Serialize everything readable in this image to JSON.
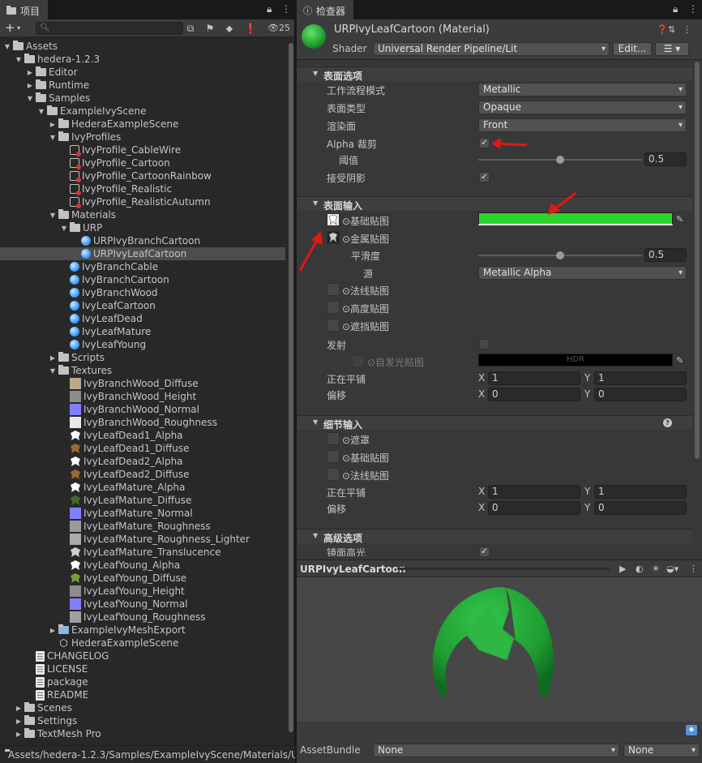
{
  "project": {
    "tab_title": "项目",
    "search_placeholder": "",
    "hidden_count": "25",
    "tree": [
      {
        "label": "Assets",
        "icon": "folder-open-icon",
        "depth": 0,
        "expanded": true
      },
      {
        "label": "hedera-1.2.3",
        "icon": "folder-open-icon",
        "depth": 1,
        "expanded": true
      },
      {
        "label": "Editor",
        "icon": "folder-icon",
        "depth": 2,
        "expanded": false
      },
      {
        "label": "Runtime",
        "icon": "folder-icon",
        "depth": 2,
        "expanded": false
      },
      {
        "label": "Samples",
        "icon": "folder-open-icon",
        "depth": 2,
        "expanded": true
      },
      {
        "label": "ExampleIvyScene",
        "icon": "folder-open-icon",
        "depth": 3,
        "expanded": true
      },
      {
        "label": "HederaExampleScene",
        "icon": "folder-icon",
        "depth": 4,
        "expanded": false
      },
      {
        "label": "IvyProfiles",
        "icon": "folder-open-icon",
        "depth": 4,
        "expanded": true
      },
      {
        "label": "IvyProfile_CableWire",
        "icon": "profile-icon",
        "depth": 5
      },
      {
        "label": "IvyProfile_Cartoon",
        "icon": "profile-icon",
        "depth": 5
      },
      {
        "label": "IvyProfile_CartoonRainbow",
        "icon": "profile-icon",
        "depth": 5
      },
      {
        "label": "IvyProfile_Realistic",
        "icon": "profile-icon",
        "depth": 5
      },
      {
        "label": "IvyProfile_RealisticAutumn",
        "icon": "profile-icon",
        "depth": 5
      },
      {
        "label": "Materials",
        "icon": "folder-open-icon",
        "depth": 4,
        "expanded": true
      },
      {
        "label": "URP",
        "icon": "folder-open-icon",
        "depth": 5,
        "expanded": true
      },
      {
        "label": "URPIvyBranchCartoon",
        "icon": "material-icon",
        "depth": 6
      },
      {
        "label": "URPIvyLeafCartoon",
        "icon": "material-icon",
        "depth": 6,
        "selected": true
      },
      {
        "label": "IvyBranchCable",
        "icon": "material-icon",
        "depth": 5
      },
      {
        "label": "IvyBranchCartoon",
        "icon": "material-icon",
        "depth": 5
      },
      {
        "label": "IvyBranchWood",
        "icon": "material-icon",
        "depth": 5
      },
      {
        "label": "IvyLeafCartoon",
        "icon": "material-icon",
        "depth": 5
      },
      {
        "label": "IvyLeafDead",
        "icon": "material-icon",
        "depth": 5
      },
      {
        "label": "IvyLeafMature",
        "icon": "material-icon",
        "depth": 5
      },
      {
        "label": "IvyLeafYoung",
        "icon": "material-icon",
        "depth": 5
      },
      {
        "label": "Scripts",
        "icon": "folder-icon",
        "depth": 4,
        "expanded": false
      },
      {
        "label": "Textures",
        "icon": "folder-open-icon",
        "depth": 4,
        "expanded": true
      },
      {
        "label": "IvyBranchWood_Diffuse",
        "icon": "texture-icon",
        "depth": 5,
        "swatch": "#b9a98a"
      },
      {
        "label": "IvyBranchWood_Height",
        "icon": "texture-icon",
        "depth": 5,
        "swatch": "#8c8c8c"
      },
      {
        "label": "IvyBranchWood_Normal",
        "icon": "texture-icon",
        "depth": 5,
        "swatch": "#8080ff"
      },
      {
        "label": "IvyBranchWood_Roughness",
        "icon": "texture-icon",
        "depth": 5,
        "swatch": "#e8e8e8"
      },
      {
        "label": "IvyLeafDead1_Alpha",
        "icon": "leaf-texture-icon",
        "depth": 5,
        "swatch": "#ffffff"
      },
      {
        "label": "IvyLeafDead1_Diffuse",
        "icon": "leaf-texture-icon",
        "depth": 5,
        "swatch": "#9a6a30"
      },
      {
        "label": "IvyLeafDead2_Alpha",
        "icon": "leaf-texture-icon",
        "depth": 5,
        "swatch": "#ffffff"
      },
      {
        "label": "IvyLeafDead2_Diffuse",
        "icon": "leaf-texture-icon",
        "depth": 5,
        "swatch": "#9a6a30"
      },
      {
        "label": "IvyLeafMature_Alpha",
        "icon": "leaf-texture-icon",
        "depth": 5,
        "swatch": "#ffffff"
      },
      {
        "label": "IvyLeafMature_Diffuse",
        "icon": "leaf-texture-icon",
        "depth": 5,
        "swatch": "#3f6a2a"
      },
      {
        "label": "IvyLeafMature_Normal",
        "icon": "texture-icon",
        "depth": 5,
        "swatch": "#8080ff"
      },
      {
        "label": "IvyLeafMature_Roughness",
        "icon": "texture-icon",
        "depth": 5,
        "swatch": "#9a9a9a"
      },
      {
        "label": "IvyLeafMature_Roughness_Lighter",
        "icon": "texture-icon",
        "depth": 5,
        "swatch": "#aaaaaa"
      },
      {
        "label": "IvyLeafMature_Translucence",
        "icon": "leaf-texture-icon",
        "depth": 5,
        "swatch": "#cfcfcf"
      },
      {
        "label": "IvyLeafYoung_Alpha",
        "icon": "leaf-texture-icon",
        "depth": 5,
        "swatch": "#ffffff"
      },
      {
        "label": "IvyLeafYoung_Diffuse",
        "icon": "leaf-texture-icon",
        "depth": 5,
        "swatch": "#6fa03a"
      },
      {
        "label": "IvyLeafYoung_Height",
        "icon": "texture-icon",
        "depth": 5,
        "swatch": "#8c8c8c"
      },
      {
        "label": "IvyLeafYoung_Normal",
        "icon": "texture-icon",
        "depth": 5,
        "swatch": "#8080ff"
      },
      {
        "label": "IvyLeafYoung_Roughness",
        "icon": "texture-icon",
        "depth": 5,
        "swatch": "#a0a0a0"
      },
      {
        "label": "ExampleIvyMeshExport",
        "icon": "prefab-folder-icon",
        "depth": 4,
        "expanded": false
      },
      {
        "label": "HederaExampleScene",
        "icon": "unity-scene-icon",
        "depth": 4
      },
      {
        "label": "CHANGELOG",
        "icon": "document-icon",
        "depth": 2
      },
      {
        "label": "LICENSE",
        "icon": "document-icon",
        "depth": 2
      },
      {
        "label": "package",
        "icon": "document-icon",
        "depth": 2
      },
      {
        "label": "README",
        "icon": "document-icon",
        "depth": 2
      },
      {
        "label": "Scenes",
        "icon": "folder-icon",
        "depth": 1,
        "expanded": false
      },
      {
        "label": "Settings",
        "icon": "folder-icon",
        "depth": 1,
        "expanded": false
      },
      {
        "label": "TextMesh Pro",
        "icon": "folder-icon",
        "depth": 1,
        "expanded": false
      }
    ],
    "path": "Assets/hedera-1.2.3/Samples/ExampleIvyScene/Materials/U"
  },
  "inspector": {
    "tab_title": "检查器",
    "material_title": "URPIvyLeafCartoon (Material)",
    "shader_label": "Shader",
    "shader_value": "Universal Render Pipeline/Lit",
    "edit_button": "Edit...",
    "surface_options": {
      "header": "表面选项",
      "workflow_label": "工作流程模式",
      "workflow_value": "Metallic",
      "surface_type_label": "表面类型",
      "surface_type_value": "Opaque",
      "render_face_label": "渲染面",
      "render_face_value": "Front",
      "alpha_clip_label": "Alpha 裁剪",
      "alpha_clip_checked": true,
      "threshold_label": "阈值",
      "threshold_value": "0.5",
      "receive_shadows_label": "接受阴影",
      "receive_shadows_checked": true
    },
    "surface_inputs": {
      "header": "表面输入",
      "base_map_label": "⊙基础贴图",
      "base_color": "#2cd52c",
      "metallic_map_label": "⊙金属贴图",
      "smoothness_label": "平滑度",
      "smoothness_value": "0.5",
      "source_label": "源",
      "source_value": "Metallic Alpha",
      "normal_map_label": "⊙法线贴图",
      "height_map_label": "⊙高度贴图",
      "occlusion_map_label": "⊙遮挡贴图",
      "emission_label": "发射",
      "emission_map_label": "⊙自发光贴图",
      "emission_hdr": "HDR",
      "tiling_label": "正在平铺",
      "tiling_x": "1",
      "tiling_y": "1",
      "offset_label": "偏移",
      "offset_x": "0",
      "offset_y": "0",
      "x_label": "X",
      "y_label": "Y"
    },
    "detail_inputs": {
      "header": "细节输入",
      "mask_label": "⊙遮罩",
      "base_map_label": "⊙基础贴图",
      "normal_map_label": "⊙法线贴图",
      "tiling_label": "正在平铺",
      "tiling_x": "1",
      "tiling_y": "1",
      "offset_label": "偏移",
      "offset_x": "0",
      "offset_y": "0"
    },
    "advanced": {
      "header": "高级选项",
      "specular_label": "镜面高光",
      "specular_checked": true
    },
    "preview_title": "URPIvyLeafCartoon",
    "assetbundle_label": "AssetBundle",
    "assetbundle_value": "None",
    "assetbundle_variant": "None"
  },
  "colors": {
    "accent_green": "#2cd52c",
    "annotation_red": "#e01818",
    "selection": "#4d4d4d"
  }
}
